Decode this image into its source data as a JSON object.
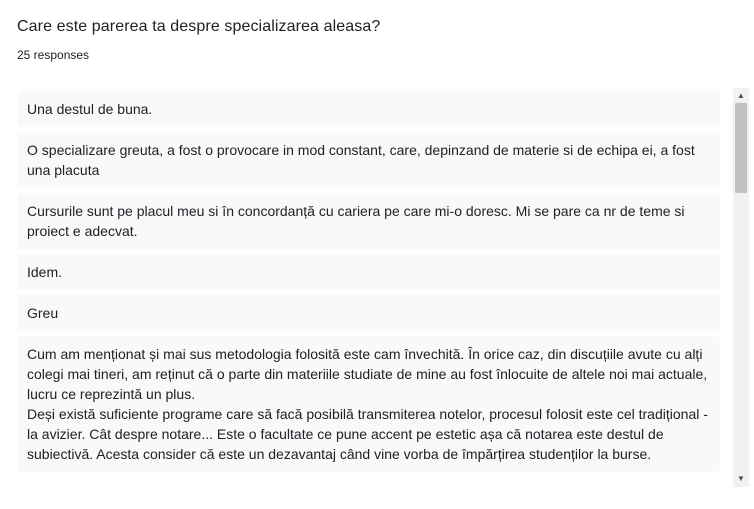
{
  "question": {
    "title": "Care este parerea ta despre specializarea aleasa?",
    "count": "25 responses"
  },
  "responses": [
    "Una destul de buna.",
    "O specializare greuta, a fost o provocare in mod constant, care, depinzand de materie si de echipa ei, a fost una placuta",
    "Cursurile sunt pe placul meu si în concordanță cu cariera pe care mi-o doresc. Mi se pare ca nr de teme si proiect e adecvat.",
    "Idem.",
    "Greu",
    "Cum am menționat și mai sus metodologia folosită este cam învechită. În orice caz, din discuțiile avute cu alți colegi mai tineri, am reținut că o parte din materiile studiate de mine au fost înlocuite de altele noi mai actuale, lucru ce reprezintă un plus.\nDeși există suficiente programe care să facă posibilă transmiterea notelor, procesul folosit este cel tradițional - la avizier. Cât despre notare... Este o facultate ce pune accent pe estetic așa că notarea este destul de subiectivă. Acesta consider că este un dezavantaj când vine vorba de împărțirea studenților la burse."
  ],
  "scrollbar": {
    "up_icon": "triangle-up-icon",
    "down_icon": "triangle-down-icon"
  }
}
